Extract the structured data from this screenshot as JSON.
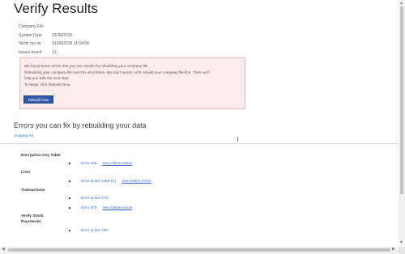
{
  "page": {
    "title": "Verify Results"
  },
  "meta": [
    {
      "label": "Company File",
      "value": ""
    },
    {
      "label": "System Date",
      "value": "01/09/2026"
    },
    {
      "label": "Verify run on",
      "value": "01/09/2026 11:54:58"
    },
    {
      "label": "Issues found",
      "value": "11"
    }
  ],
  "notice": {
    "lines": [
      "We found some errors that you can resolve by rebuilding your company file.",
      "Rebuilding your company file won't fix all of them. But don't worry! Let's rebuild your company file first. Then we'll",
      "help you with the next step.",
      "To begin, click Rebuild Now."
    ],
    "button_label": "Rebuild Now"
  },
  "section": {
    "title": "Errors you can fix by rebuilding your data",
    "expand_all": "Expand All"
  },
  "groups": [
    {
      "label_lines": [
        "Encryption Key Table"
      ],
      "errors": [
        {
          "code": "Error 306",
          "article": "See Online Article"
        }
      ]
    },
    {
      "label_lines": [
        "Lists"
      ],
      "errors": [
        {
          "code": "Error at line 1268 (C)",
          "article": "See Online Article"
        }
      ]
    },
    {
      "label_lines": [
        "Transactions"
      ],
      "errors": [
        {
          "code": "Error at line 279",
          "article": ""
        },
        {
          "code": "Error 579",
          "article": "See Online Article"
        }
      ]
    },
    {
      "label_lines": [
        "Verify Stock",
        "Paychecks"
      ],
      "errors": [
        {
          "code": "Error at line 183",
          "article": ""
        }
      ]
    }
  ],
  "icons": {
    "scroll_up": "arrow-up-icon",
    "scroll_down": "arrow-down-icon",
    "scroll_left": "arrow-left-icon",
    "scroll_right": "arrow-right-icon",
    "bullet": "triangle-bullet-icon"
  },
  "colors": {
    "link": "#3366cc",
    "button": "#2f5aa8",
    "notice_bg": "#fdecec",
    "notice_border": "#f2b8b8"
  }
}
